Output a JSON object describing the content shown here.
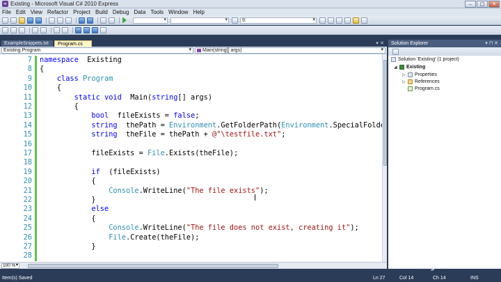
{
  "window": {
    "title": "Existing - Microsoft Visual C# 2010 Express",
    "icon": "visual-studio-icon",
    "controls": [
      "minimize-icon",
      "maximize-icon",
      "close-icon"
    ]
  },
  "menu": [
    "File",
    "Edit",
    "View",
    "Refactor",
    "Project",
    "Build",
    "Debug",
    "Data",
    "Tools",
    "Window",
    "Help"
  ],
  "toolbar": {
    "find_combo_value": "",
    "config_combo_value": "",
    "line_combo_value": "9:"
  },
  "tabs": [
    {
      "label": "ExampleSnippets.txt",
      "active": false
    },
    {
      "label": "Program.cs",
      "active": true
    }
  ],
  "navbar": {
    "type_combo": "Existing.Program",
    "member_combo": "Main(string[] args)"
  },
  "editor": {
    "lines": [
      {
        "n": "7",
        "tokens": [
          [
            "kw",
            "namespace"
          ],
          [
            "",
            "  Existing"
          ]
        ]
      },
      {
        "n": "8",
        "tokens": [
          [
            "",
            "{"
          ]
        ]
      },
      {
        "n": "9",
        "tokens": [
          [
            "",
            "    "
          ],
          [
            "kw",
            "class"
          ],
          [
            "tp",
            " Program"
          ]
        ]
      },
      {
        "n": "10",
        "tokens": [
          [
            "",
            "    {"
          ]
        ]
      },
      {
        "n": "11",
        "tokens": [
          [
            "",
            "        "
          ],
          [
            "kw",
            "static void"
          ],
          [
            "",
            "  Main("
          ],
          [
            "kw",
            "string"
          ],
          [
            "",
            "[] args)"
          ]
        ]
      },
      {
        "n": "12",
        "tokens": [
          [
            "",
            "        {"
          ]
        ]
      },
      {
        "n": "13",
        "tokens": [
          [
            "",
            "            "
          ],
          [
            "kw",
            "bool"
          ],
          [
            "",
            "  fileExists = "
          ],
          [
            "kw",
            "false"
          ],
          [
            "",
            ";"
          ]
        ]
      },
      {
        "n": "14",
        "tokens": [
          [
            "",
            "            "
          ],
          [
            "kw",
            "string"
          ],
          [
            "",
            "  thePath = "
          ],
          [
            "tp",
            "Environment"
          ],
          [
            "",
            ".GetFolderPath("
          ],
          [
            "tp",
            "Environment"
          ],
          [
            "",
            ".SpecialFolder"
          ]
        ]
      },
      {
        "n": "15",
        "tokens": [
          [
            "",
            "            "
          ],
          [
            "kw",
            "string"
          ],
          [
            "",
            "  theFile = thePath + "
          ],
          [
            "str",
            "@\"\\testfile.txt\""
          ],
          [
            "",
            ";"
          ]
        ]
      },
      {
        "n": "16",
        "tokens": []
      },
      {
        "n": "17",
        "tokens": [
          [
            "",
            "            fileExists = "
          ],
          [
            "tp",
            "File"
          ],
          [
            "",
            ".Exists(theFile);"
          ]
        ]
      },
      {
        "n": "18",
        "tokens": []
      },
      {
        "n": "19",
        "tokens": [
          [
            "",
            "            "
          ],
          [
            "kw",
            "if"
          ],
          [
            "",
            "  (fileExists)"
          ]
        ]
      },
      {
        "n": "20",
        "tokens": [
          [
            "",
            "            {"
          ]
        ]
      },
      {
        "n": "21",
        "tokens": [
          [
            "",
            "                "
          ],
          [
            "tp",
            "Console"
          ],
          [
            "",
            ".WriteLine("
          ],
          [
            "str",
            "\"The file exists\""
          ],
          [
            "",
            ");"
          ]
        ]
      },
      {
        "n": "22",
        "tokens": [
          [
            "",
            "            }"
          ]
        ]
      },
      {
        "n": "23",
        "tokens": [
          [
            "",
            "            "
          ],
          [
            "kw",
            "else"
          ]
        ]
      },
      {
        "n": "24",
        "tokens": [
          [
            "",
            "            {"
          ]
        ]
      },
      {
        "n": "25",
        "tokens": [
          [
            "",
            "                "
          ],
          [
            "tp",
            "Console"
          ],
          [
            "",
            ".WriteLine("
          ],
          [
            "str",
            "\"The file does not exist, creating it\""
          ],
          [
            "",
            ");"
          ]
        ]
      },
      {
        "n": "26",
        "tokens": [
          [
            "",
            "                "
          ],
          [
            "tp",
            "File"
          ],
          [
            "",
            ".Create(theFile);"
          ]
        ]
      },
      {
        "n": "27",
        "tokens": [
          [
            "",
            "            }"
          ]
        ]
      },
      {
        "n": "28",
        "tokens": []
      }
    ],
    "zoom": "100 %"
  },
  "solution_explorer": {
    "title": "Solution Explorer",
    "header_buttons": "▾ ⊓ ✕",
    "solution": "Solution 'Existing' (1 project)",
    "project": "Existing",
    "items": [
      "Properties",
      "References",
      "Program.cs"
    ]
  },
  "status": {
    "message": "Item(s) Saved",
    "ln": "Ln 27",
    "col": "Col 14",
    "ch": "Ch 14",
    "ins": "INS"
  },
  "watermark": "lynda.com",
  "colors": {
    "keyword": "#0000ff",
    "type": "#2b91af",
    "string": "#a31515",
    "chrome": "#2b3c59"
  }
}
